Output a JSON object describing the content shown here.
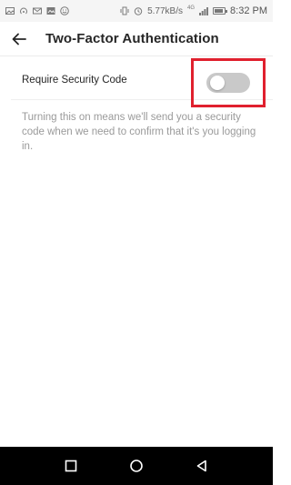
{
  "status_bar": {
    "network_speed": "5.77kB/s",
    "network_type": "4G",
    "time": "8:32 PM"
  },
  "app_bar": {
    "title": "Two-Factor Authentication"
  },
  "setting": {
    "label": "Require Security Code",
    "enabled": false,
    "description": "Turning this on means we'll send you a security code when we need to confirm that it's you logging in."
  },
  "colors": {
    "highlight_box": "#e0202e",
    "toggle_off": "#c9c9c9",
    "description_text": "#9a9a9a"
  },
  "icons": {
    "back": "arrow-left-icon",
    "nav_recent": "square-icon",
    "nav_home": "circle-icon",
    "nav_back": "triangle-icon"
  }
}
